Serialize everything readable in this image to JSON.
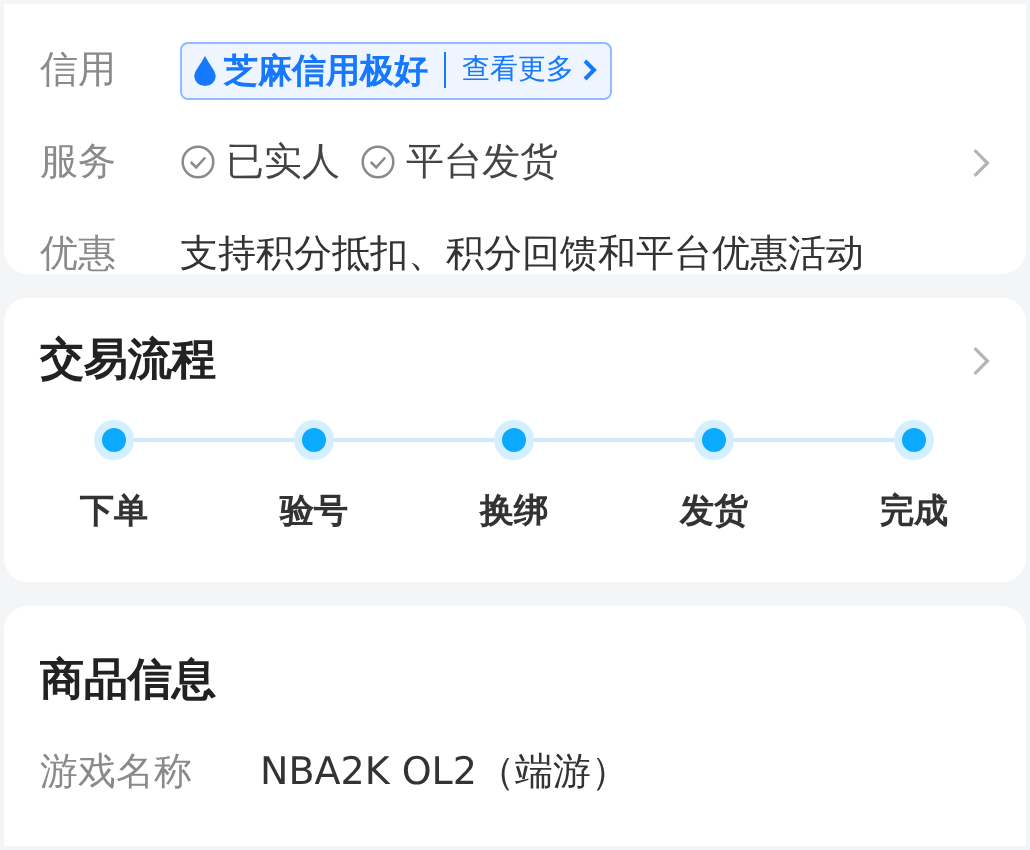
{
  "info_card": {
    "credit": {
      "label": "信用",
      "badge": "芝麻信用极好",
      "more": "查看更多"
    },
    "services": {
      "label": "服务",
      "items": [
        "已实人",
        "平台发货"
      ]
    },
    "offers": {
      "label": "优惠",
      "text": "支持积分抵扣、积分回馈和平台优惠活动"
    }
  },
  "trade_flow": {
    "title": "交易流程",
    "steps": [
      "下单",
      "验号",
      "换绑",
      "发货",
      "完成"
    ]
  },
  "product_info": {
    "title": "商品信息",
    "fields": [
      {
        "label": "游戏名称",
        "value": "NBA2K OL2（端游）"
      }
    ]
  }
}
